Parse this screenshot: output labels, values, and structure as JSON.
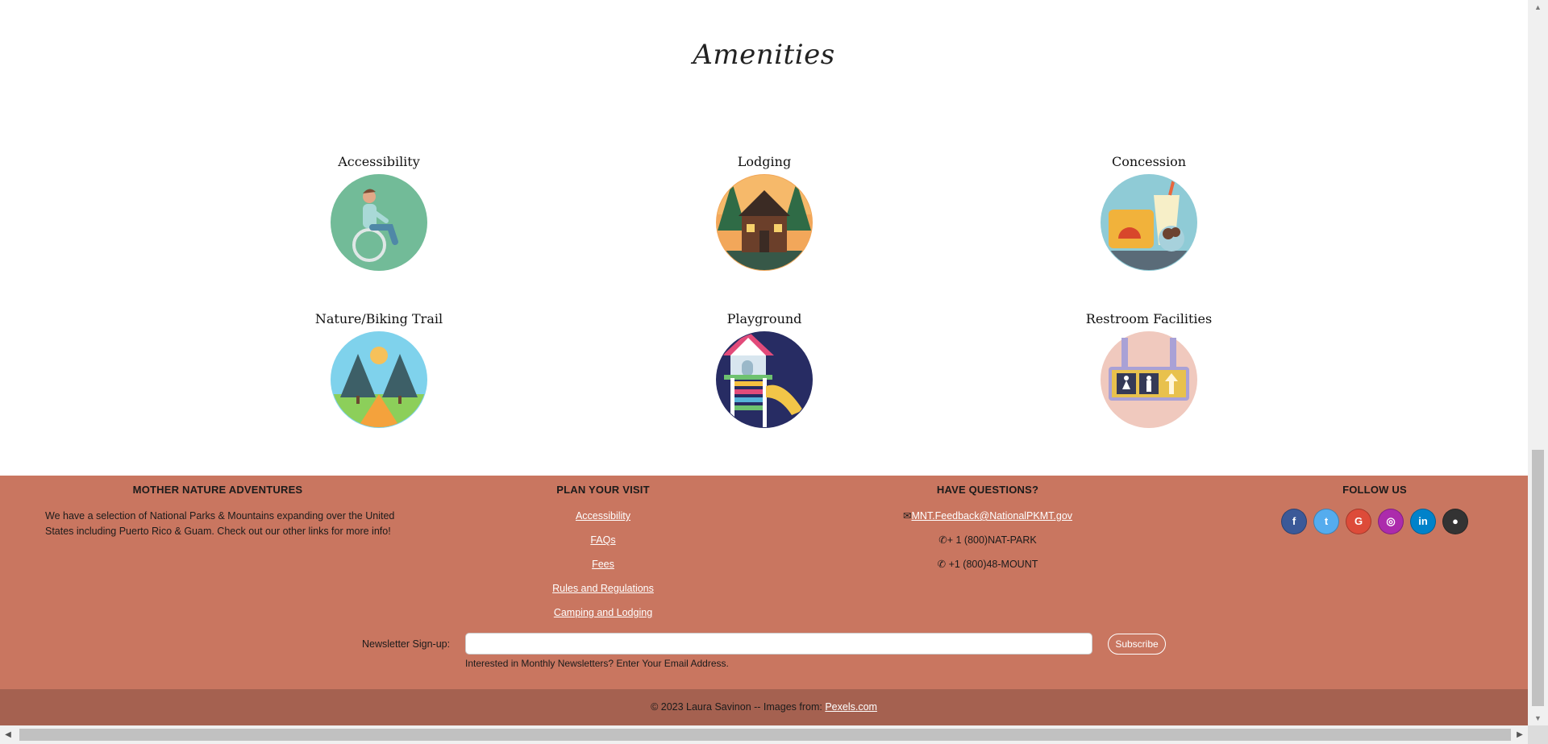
{
  "amenities": {
    "title": "Amenities",
    "items": [
      {
        "label": "Accessibility",
        "icon": "wheelchair-icon"
      },
      {
        "label": "Lodging",
        "icon": "cabin-icon"
      },
      {
        "label": "Concession",
        "icon": "food-drink-icon"
      },
      {
        "label": "Nature/Biking Trail",
        "icon": "trail-icon"
      },
      {
        "label": "Playground",
        "icon": "playground-icon"
      },
      {
        "label": "Restroom Facilities",
        "icon": "restroom-sign-icon"
      }
    ]
  },
  "footer": {
    "about": {
      "heading": "MOTHER NATURE ADVENTURES",
      "text": "We have a selection of National Parks & Mountains expanding over the United States including Puerto Rico & Guam. Check out our other links for more info!"
    },
    "plan": {
      "heading": "PLAN YOUR VISIT",
      "links": [
        "Accessibility",
        "FAQs",
        "Fees",
        "Rules and Regulations",
        "Camping and Lodging"
      ]
    },
    "questions": {
      "heading": "HAVE QUESTIONS?",
      "email": "MNT.Feedback@NationalPKMT.gov",
      "phone1": "+ 1 (800)NAT-PARK",
      "phone2": "+1 (800)48-MOUNT"
    },
    "follow": {
      "heading": "FOLLOW US",
      "social": [
        {
          "name": "facebook-icon",
          "glyph": "f",
          "color": "#3b5998"
        },
        {
          "name": "twitter-icon",
          "glyph": "t",
          "color": "#55acee"
        },
        {
          "name": "google-icon",
          "glyph": "G",
          "color": "#dd4b39"
        },
        {
          "name": "instagram-icon",
          "glyph": "◎",
          "color": "#ac2bac"
        },
        {
          "name": "linkedin-icon",
          "glyph": "in",
          "color": "#0082ca"
        },
        {
          "name": "github-icon",
          "glyph": "●",
          "color": "#333333"
        }
      ]
    },
    "newsletter": {
      "label": "Newsletter Sign-up:",
      "button": "Subscribe",
      "help": "Interested in Monthly Newsletters? Enter Your Email Address.",
      "value": ""
    },
    "copyright": {
      "text": "© 2023 Laura Savinon -- Images from: ",
      "link": "Pexels.com"
    }
  },
  "colors": {
    "footer_bg": "#c97660",
    "copyright_bg": "#a56150"
  }
}
